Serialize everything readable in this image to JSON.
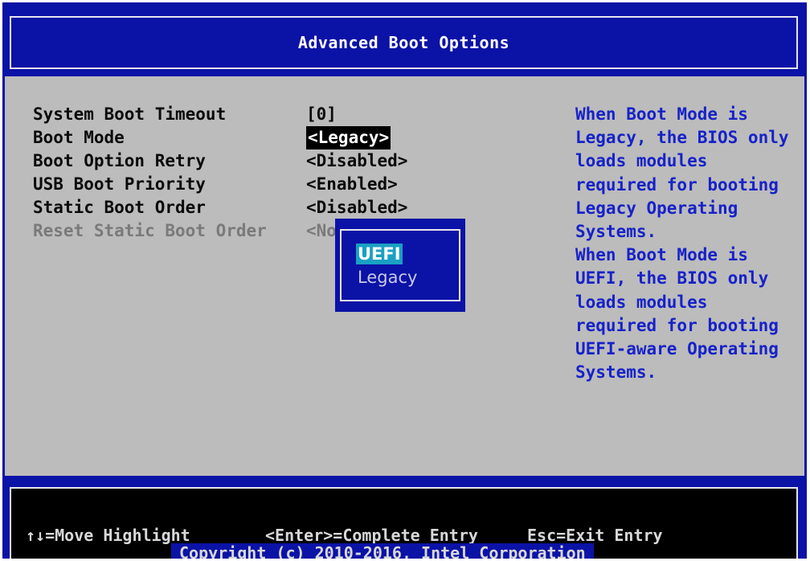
{
  "header": {
    "title": "Advanced Boot Options"
  },
  "settings": [
    {
      "label": "System Boot Timeout",
      "value": "[0]",
      "selected": false,
      "disabled": false
    },
    {
      "label": "Boot Mode",
      "value": "<Legacy>",
      "selected": true,
      "disabled": false
    },
    {
      "label": "Boot Option Retry",
      "value": "<Disabled>",
      "selected": false,
      "disabled": false
    },
    {
      "label": "USB Boot Priority",
      "value": "<Enabled>",
      "selected": false,
      "disabled": false
    },
    {
      "label": "Static Boot Order",
      "value": "<Disabled>",
      "selected": false,
      "disabled": false
    },
    {
      "label": "Reset Static Boot Order",
      "value": "<No",
      "selected": false,
      "disabled": true
    }
  ],
  "help": {
    "lines": [
      "When Boot Mode is",
      "Legacy, the BIOS only",
      "loads modules",
      "required for booting",
      "Legacy Operating",
      "Systems.",
      "When Boot Mode is",
      "UEFI, the BIOS only",
      "loads modules",
      "required for booting",
      "UEFI-aware Operating",
      "Systems."
    ]
  },
  "popup": {
    "options": [
      {
        "label": "UEFI",
        "highlighted": true
      },
      {
        "label": "Legacy",
        "highlighted": false
      }
    ]
  },
  "footer": {
    "move": "↑↓=Move Highlight",
    "enter": "<Enter>=Complete Entry",
    "esc": "Esc=Exit Entry",
    "copyright": "Copyright (c) 2010-2016, Intel Corporation"
  },
  "colors": {
    "bios_blue": "#0b12a6",
    "panel_gray": "#bcbcbc",
    "help_text": "#1722c8",
    "popup_highlight": "#1aa0c4"
  }
}
